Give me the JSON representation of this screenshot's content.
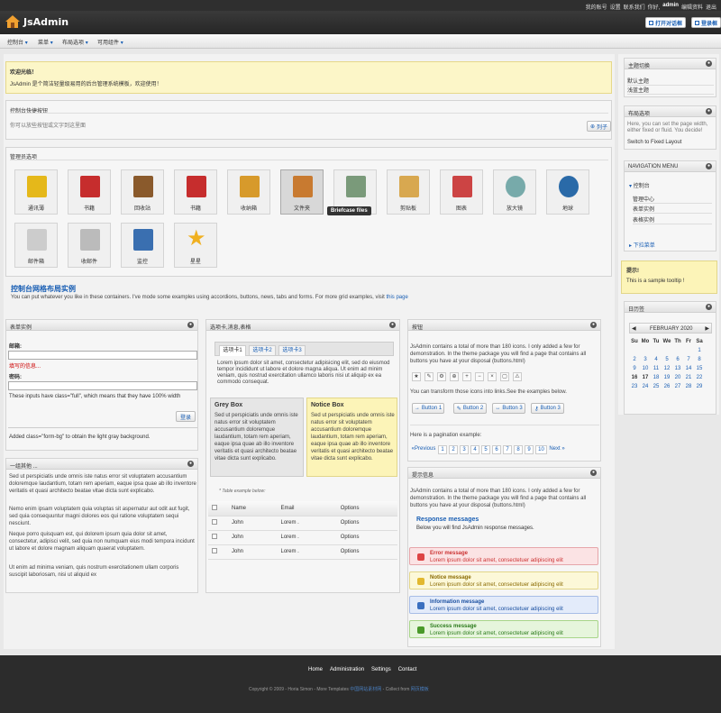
{
  "topbar": {
    "hello": "你好,",
    "user": "admin",
    "edit": "编辑资料",
    "logout": "退出",
    "account": "我的账号",
    "settings": "设置",
    "contact": "联系我们"
  },
  "header": {
    "title": "JsAdmin",
    "btn_open": "打开对话框",
    "btn_login": "登录框"
  },
  "menu": [
    "控制台",
    "菜单",
    "布局选项",
    "可用组件"
  ],
  "welcome": {
    "title": "欢迎光临！",
    "text": "JsAdmin 是个简洁轻量级易用的后台管理系统模板，欢迎使用！"
  },
  "quick": {
    "title": "控制台快捷按钮",
    "text": "你可以放些按钮或文字到这里面",
    "btn": "列子"
  },
  "manager": {
    "title": "管理员选项",
    "tooltip": "Briefcase files",
    "icons": [
      {
        "name": "contacts",
        "label": "通讯薄",
        "color": "#e5b81a"
      },
      {
        "name": "book",
        "label": "书籍",
        "color": "#c62d2d"
      },
      {
        "name": "recycle",
        "label": "回收站",
        "color": "#8a5a2c"
      },
      {
        "name": "book2",
        "label": "书籍",
        "color": "#c62d2d"
      },
      {
        "name": "folder",
        "label": "收纳箱",
        "color": "#d79a2b"
      },
      {
        "name": "briefcase",
        "label": "文件夹",
        "color": "#c87a30"
      },
      {
        "name": "photo",
        "label": "",
        "color": "#7a9a7a"
      },
      {
        "name": "clipboard",
        "label": "剪贴板",
        "color": "#d8a850"
      },
      {
        "name": "chart",
        "label": "图表",
        "color": "#c44"
      },
      {
        "name": "zoom",
        "label": "放大镜",
        "color": "#7aa"
      },
      {
        "name": "globe",
        "label": "地球",
        "color": "#2a6aa8"
      },
      {
        "name": "mail-edit",
        "label": "邮件箱",
        "color": "#ccc"
      },
      {
        "name": "mail",
        "label": "收邮件",
        "color": "#bbb"
      },
      {
        "name": "monitor",
        "label": "监控",
        "color": "#3a6fb0"
      },
      {
        "name": "star",
        "label": "星星",
        "color": "#f0b020"
      }
    ]
  },
  "grid": {
    "title": "控制台网格布局实例",
    "text": "You can put whatever you like in these containers. I've mode some examples using accordions, buttons, news, tabs and forms. For more grid examples, visit",
    "link": "this page"
  },
  "form": {
    "title": "表单实例",
    "email": "邮箱:",
    "error": "填写的信息...",
    "password": "密码:",
    "note": "These inputs have class=\"full\", which means that they have 100% width",
    "login": "登录",
    "note2": "Added class=\"form-bg\" to obtain the light gray background."
  },
  "other": {
    "title": "一组其他 ...",
    "p1": "Sed ut perspiciatis unde omnis iste natus error sit voluptatem accusantium doloremque laudantium, totam rem aperiam, eaque ipsa quae ab illo inventore veritatis et quasi architecto beatae vitae dicta sunt explicabo.",
    "p2": "Nemo enim ipsam voluptatem quia voluptas sit aspernatur aut odit aut fugit, sed quia consequuntur magni dolores eos qui ratione voluptatem sequi nesciunt.",
    "p3": "Neque porro quisquam est, qui dolorem ipsum quia dolor sit amet, consectetur, adipisci velit, sed quia non numquam eius modi tempora incidunt ut labore et dolore magnam aliquam quaerat voluptatem.",
    "p4": "Ut enim ad minima veniam, quis nostrum exercitationem ullam corporis suscipit laboriosam, nisi ut aliquid ex"
  },
  "tabs": {
    "title": "选项卡,消息,表格",
    "tab1": "选项卡1",
    "tab2": "选项卡2",
    "tab3": "选项卡3",
    "text": "Lorem ipsum dolor sit amet, consectetur adipisicing elit, sed do eiusmod tempor incididunt ut labore et dolore magna aliqua. Ut enim ad minim veniam, quis nostrud exercitation ullamco laboris nisi ut aliquip ex ea commodo consequat.",
    "grey_title": "Grey Box",
    "notice_title": "Notice Box",
    "box_text": "Sed ut perspiciatis unde omnis iste natus error sit voluptatem accusantium doloremque laudantium, totam rem aperiam, eaque ipsa quae ab illo inventore veritatis et quasi architecto beatae vitae dicta sunt explicabo.",
    "table_caption": "* Table example below:",
    "cols": [
      "Name",
      "Email",
      "Options"
    ],
    "rows": [
      [
        "John",
        "Lorem .",
        "Options"
      ],
      [
        "John",
        "Lorem .",
        "Options"
      ],
      [
        "John",
        "Lorem .",
        "Options"
      ]
    ]
  },
  "buttons": {
    "title": "按钮",
    "text": "JsAdmin contains a total of more than 180 icons. I only added a few for demonstration. In the theme package you will find a page that contains all buttons you have at your disposal (buttons.html)",
    "text2": "You can transform those icons into links.See the examples below.",
    "b1": "Button 1",
    "b2": "Button 2",
    "b3": "Button 3",
    "b4": "Button 3",
    "pag_text": "Here is a pagination example:",
    "prev": "«Previous",
    "next": "Next »",
    "pages": [
      "1",
      "2",
      "3",
      "4",
      "5",
      "6",
      "7",
      "8",
      "9",
      "10"
    ]
  },
  "msgs": {
    "title": "提示信息",
    "text": "JsAdmin contains a total of more than 180 icons. I only added a few for demonstration. In the theme package you will find a page that contains all buttons you have at your disposal (buttons.html)",
    "resp_title": "Response messages",
    "resp_sub": "Below you will find JsAdmin response messages.",
    "items": [
      {
        "t": "Error message",
        "d": "Lorem ipsum dolor sit amet, consectetuer adipiscing elit",
        "bg": "#fbe3e4",
        "bd": "#e6a6aa",
        "tc": "#c33"
      },
      {
        "t": "Notice message",
        "d": "Lorem ipsum dolor sit amet, consectetuer adipiscing elit",
        "bg": "#fcf8d8",
        "bd": "#e2d68a",
        "tc": "#8a6a00"
      },
      {
        "t": "Information message",
        "d": "Lorem ipsum dolor sit amet, consectetuer adipiscing elit",
        "bg": "#e3ebfa",
        "bd": "#a8bde6",
        "tc": "#1a4fa0"
      },
      {
        "t": "Success message",
        "d": "Lorem ipsum dolor sit amet, consectetuer adipiscing elit",
        "bg": "#e6f5dc",
        "bd": "#a8d58a",
        "tc": "#2a7a1a"
      }
    ]
  },
  "side": {
    "theme_title": "主题切换",
    "theme1": "默认主题",
    "theme2": "浅蓝主题",
    "layout_title": "布局选项",
    "layout_text": "Here, you can set the page width, either fixed or fluid. You decide!",
    "layout_link": "Switch to Fixed Layout",
    "nav_title": "NAVIGATION MENU",
    "nav_root": "控制台",
    "nav_items": [
      "管理中心",
      "表单实例",
      "表格实例"
    ],
    "nav_drop": "下拉菜单",
    "tip_title": "提示!",
    "tip_text": "This is a sample tooltip !",
    "cal_title": "日历签",
    "month": "FEBRUARY 2020",
    "days": [
      "Su",
      "Mo",
      "Tu",
      "We",
      "Th",
      "Fr",
      "Sa"
    ],
    "weeks": [
      [
        "",
        "",
        "",
        "",
        "",
        "",
        "1"
      ],
      [
        "2",
        "3",
        "4",
        "5",
        "6",
        "7",
        "8"
      ],
      [
        "9",
        "10",
        "11",
        "12",
        "13",
        "14",
        "15"
      ],
      [
        "16",
        "17",
        "18",
        "19",
        "20",
        "21",
        "22"
      ],
      [
        "23",
        "24",
        "25",
        "26",
        "27",
        "28",
        "29"
      ]
    ]
  },
  "footer": {
    "links": [
      "Home",
      "Administration",
      "Settings",
      "Contact"
    ],
    "copy": "Copyright © 2009 - Horia Simon - More Templates",
    "t1": "中国网站素材网",
    "sep": " - Collect from",
    "t2": "网页模板"
  }
}
